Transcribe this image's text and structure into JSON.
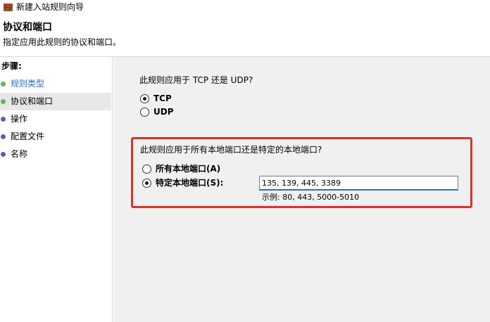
{
  "window": {
    "title": "新建入站规则向导",
    "icon": "firewall-app-icon"
  },
  "header": {
    "title": "协议和端口",
    "subtitle": "指定应用此规则的协议和端口。"
  },
  "sidebar": {
    "heading": "步骤:",
    "steps": [
      {
        "label": "规则类型",
        "state": "done"
      },
      {
        "label": "协议和端口",
        "state": "current"
      },
      {
        "label": "操作",
        "state": "pending"
      },
      {
        "label": "配置文件",
        "state": "pending"
      },
      {
        "label": "名称",
        "state": "pending"
      }
    ]
  },
  "protocol": {
    "question": "此规则应用于 TCP 还是 UDP?",
    "options": [
      {
        "label": "TCP",
        "checked": true
      },
      {
        "label": "UDP",
        "checked": false
      }
    ]
  },
  "ports": {
    "question": "此规则应用于所有本地端口还是特定的本地端口?",
    "options": [
      {
        "label": "所有本地端口(A)",
        "checked": false
      },
      {
        "label": "特定本地端口(S):",
        "checked": true
      }
    ],
    "input_value": "135, 139, 445, 3389",
    "example": "示例: 80, 443, 5000-5010"
  },
  "colors": {
    "highlight_border": "#d9332b",
    "step_done_dot": "#5cb85c",
    "step_pending_dot": "#5a5fb0",
    "step_done_text": "#2a6ebd",
    "input_focus": "#2b6dc9"
  }
}
